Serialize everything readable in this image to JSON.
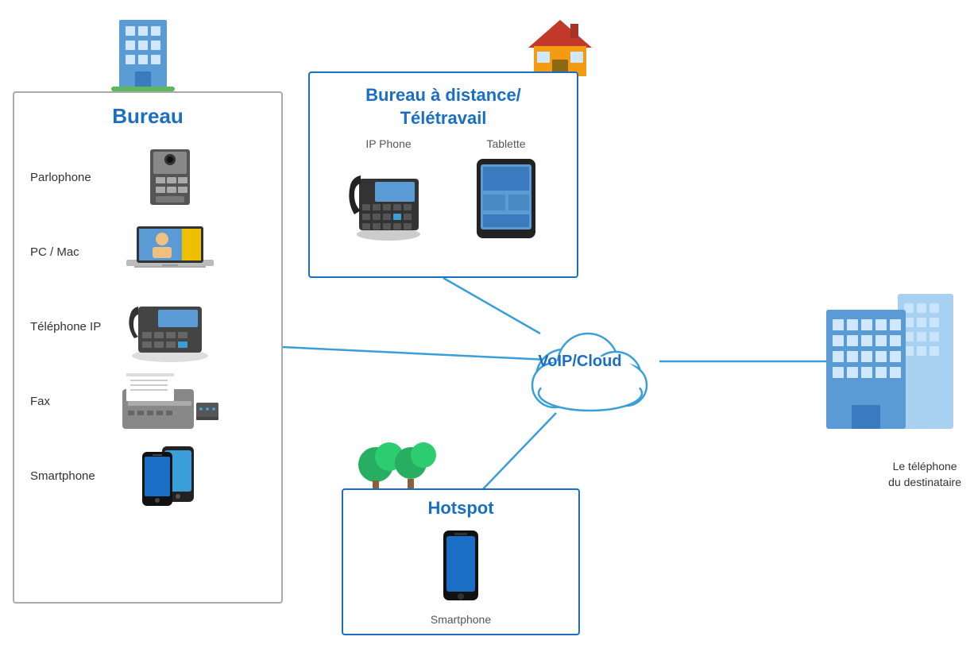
{
  "bureau": {
    "title": "Bureau",
    "items": [
      {
        "label": "Parlophone",
        "icon": "parlophone"
      },
      {
        "label": "PC / Mac",
        "icon": "pc"
      },
      {
        "label": "Téléphone IP",
        "icon": "ip-phone"
      },
      {
        "label": "Fax",
        "icon": "fax"
      },
      {
        "label": "Smartphone",
        "icon": "smartphone"
      }
    ]
  },
  "remote": {
    "title": "Bureau à distance/\nTélétravail",
    "items": [
      {
        "label": "IP Phone",
        "icon": "ip-phone"
      },
      {
        "label": "Tablette",
        "icon": "tablet"
      }
    ]
  },
  "hotspot": {
    "title": "Hotspot",
    "items": [
      {
        "label": "Smartphone",
        "icon": "smartphone"
      }
    ]
  },
  "voip": {
    "label": "VoIP/Cloud"
  },
  "destinataire": {
    "label": "Le téléphone\ndu destinataire"
  },
  "colors": {
    "blue": "#1a6fc4",
    "line": "#3a9fd8"
  }
}
